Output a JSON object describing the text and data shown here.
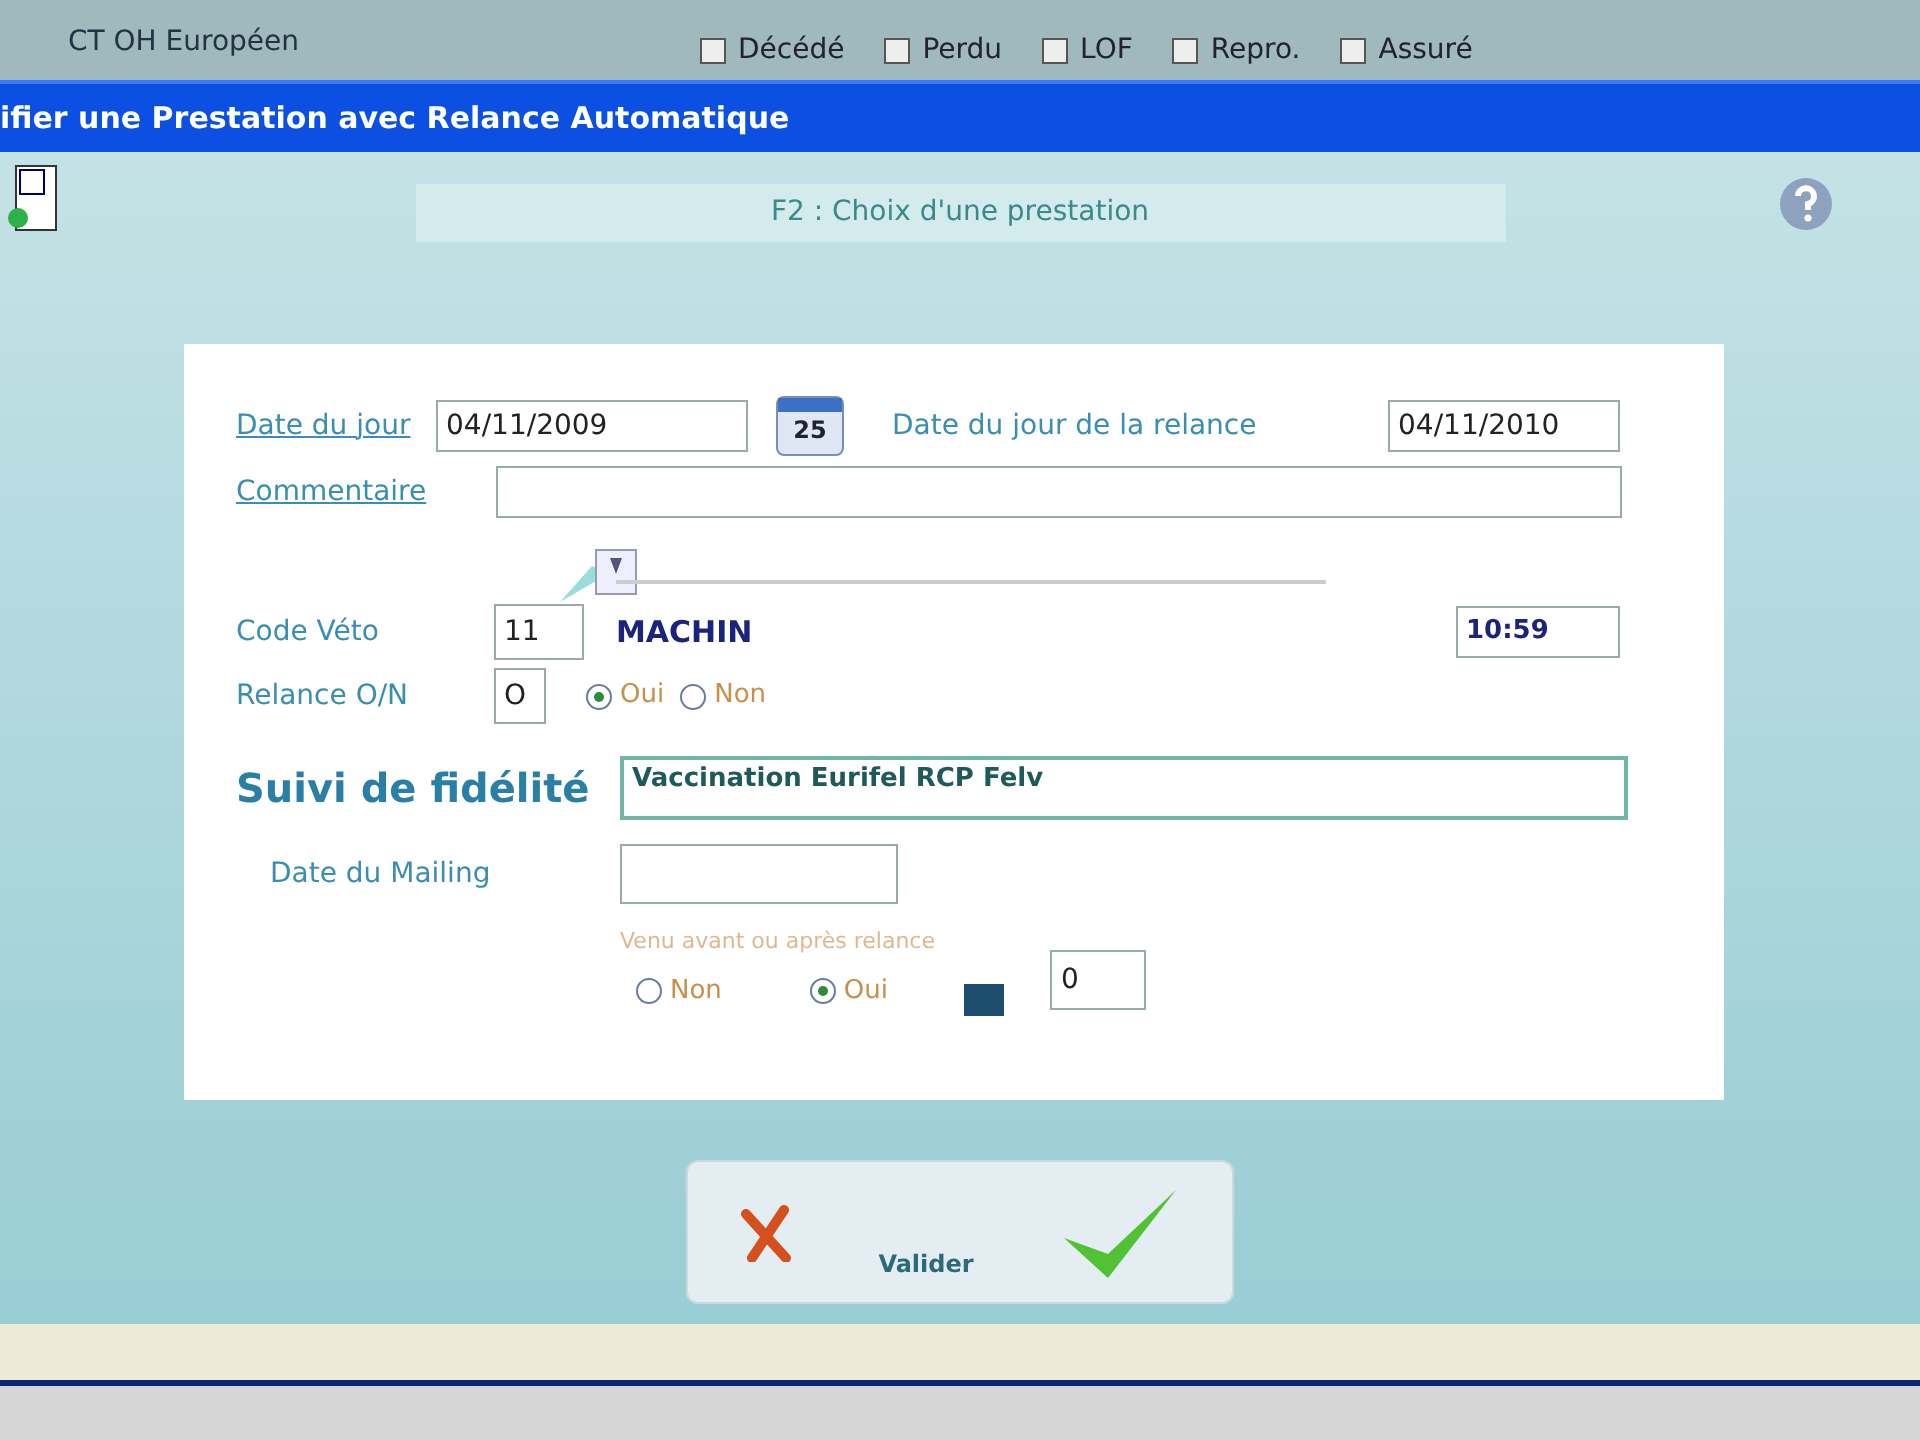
{
  "background": {
    "label": "CT OH Européen",
    "checkboxes": [
      {
        "label": "Décédé",
        "checked": false
      },
      {
        "label": "Perdu",
        "checked": false
      },
      {
        "label": "LOF",
        "checked": false
      },
      {
        "label": "Repro.",
        "checked": false
      },
      {
        "label": "Assuré",
        "checked": false
      }
    ]
  },
  "dialog": {
    "title": "ifier une Prestation avec Relance Automatique",
    "header": "F2 : Choix d'une prestation",
    "date_du_jour": {
      "label": "Date du jour",
      "value": "04/11/2009"
    },
    "calendar_day": "25",
    "date_relance": {
      "label": "Date du jour de la relance",
      "value": "04/11/2010"
    },
    "commentaire": {
      "label": "Commentaire"
    },
    "code_veto": {
      "label": "Code Véto",
      "value": "11",
      "name": "MACHIN",
      "time": "10:59"
    },
    "relance": {
      "label": "Relance O/N",
      "value": "O",
      "options": [
        {
          "label": "Oui",
          "selected": true
        },
        {
          "label": "Non",
          "selected": false
        }
      ]
    },
    "suivi": {
      "label": "Suivi de fidélité",
      "value": "Vaccination Eurifel RCP Felv"
    },
    "date_mailing": {
      "label": "Date du Mailing"
    },
    "venu": {
      "caption": "Venu avant ou après relance",
      "options": [
        {
          "label": "Non",
          "selected": false
        },
        {
          "label": "Oui",
          "selected": true
        }
      ],
      "count": "0"
    },
    "button": "Valider"
  }
}
